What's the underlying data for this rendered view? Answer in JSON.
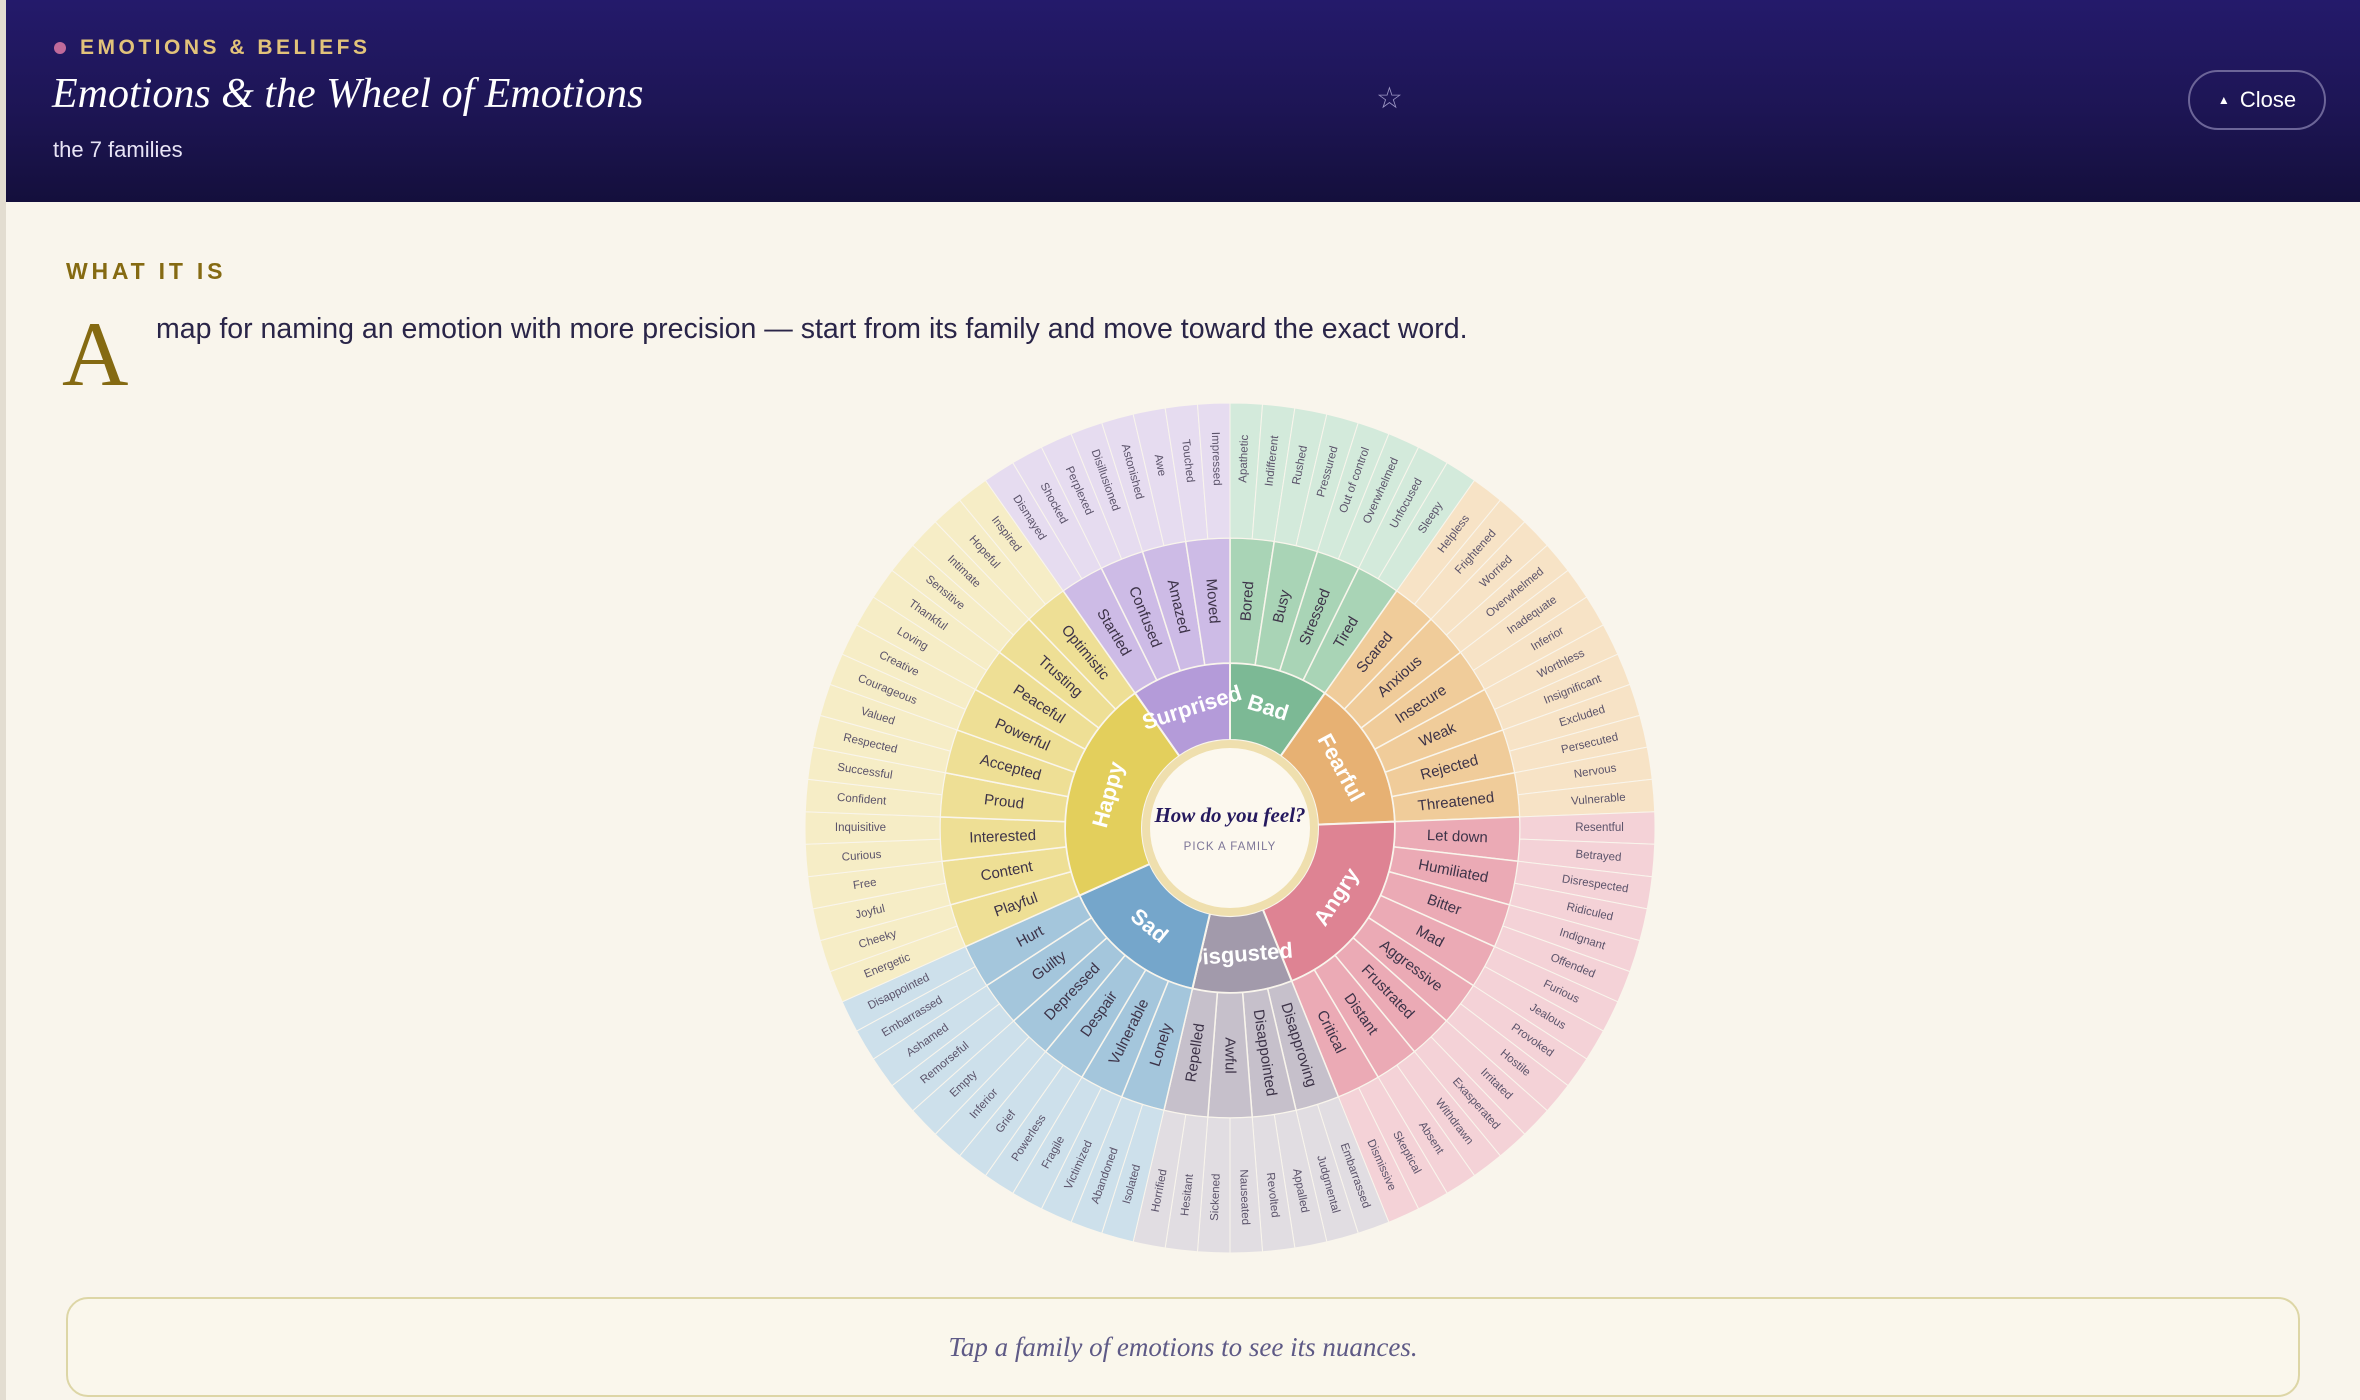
{
  "header": {
    "category": "EMOTIONS & BELIEFS",
    "title": "Emotions & the Wheel of Emotions",
    "subtitle": "the 7 families",
    "close_label": "Close",
    "favorite_icon": "star-outline-icon",
    "close_icon": "caret-up-icon"
  },
  "section": {
    "title": "WHAT IT IS",
    "dropcap": "A",
    "lead": "map for naming an emotion with more precision — start from its family and move toward the exact word."
  },
  "wheel": {
    "center_title": "How do you feel?",
    "center_sub": "PICK A FAMILY",
    "families": [
      {
        "name": "Bad",
        "color": "#7cb995",
        "mid": "#a9d4b6",
        "outer": "#d3eadb",
        "subs": [
          {
            "name": "Bored",
            "leaves": [
              "Apathetic",
              "Indifferent"
            ]
          },
          {
            "name": "Busy",
            "leaves": [
              "Rushed",
              "Pressured"
            ]
          },
          {
            "name": "Stressed",
            "leaves": [
              "Out of control",
              "Overwhelmed"
            ]
          },
          {
            "name": "Tired",
            "leaves": [
              "Unfocused",
              "Sleepy"
            ]
          }
        ]
      },
      {
        "name": "Fearful",
        "color": "#e7b173",
        "mid": "#f0cc9a",
        "outer": "#f7e3c6",
        "subs": [
          {
            "name": "Scared",
            "leaves": [
              "Helpless",
              "Frightened"
            ]
          },
          {
            "name": "Anxious",
            "leaves": [
              "Worried",
              "Overwhelmed"
            ]
          },
          {
            "name": "Insecure",
            "leaves": [
              "Inadequate",
              "Inferior"
            ]
          },
          {
            "name": "Weak",
            "leaves": [
              "Worthless",
              "Insignificant"
            ]
          },
          {
            "name": "Rejected",
            "leaves": [
              "Excluded",
              "Persecuted"
            ]
          },
          {
            "name": "Threatened",
            "leaves": [
              "Nervous",
              "Vulnerable"
            ]
          }
        ]
      },
      {
        "name": "Angry",
        "color": "#de8393",
        "mid": "#ebaab5",
        "outer": "#f4d2d7",
        "subs": [
          {
            "name": "Let down",
            "leaves": [
              "Resentful",
              "Betrayed"
            ]
          },
          {
            "name": "Humiliated",
            "leaves": [
              "Disrespected",
              "Ridiculed"
            ]
          },
          {
            "name": "Bitter",
            "leaves": [
              "Indignant",
              "Offended"
            ]
          },
          {
            "name": "Mad",
            "leaves": [
              "Furious",
              "Jealous"
            ]
          },
          {
            "name": "Aggressive",
            "leaves": [
              "Provoked",
              "Hostile"
            ]
          },
          {
            "name": "Frustrated",
            "leaves": [
              "Irritated",
              "Exasperated"
            ]
          },
          {
            "name": "Distant",
            "leaves": [
              "Withdrawn",
              "Absent"
            ]
          },
          {
            "name": "Critical",
            "leaves": [
              "Skeptical",
              "Dismissive"
            ]
          }
        ]
      },
      {
        "name": "Disgusted",
        "color": "#a29aab",
        "mid": "#c6c0cb",
        "outer": "#e1dde2",
        "subs": [
          {
            "name": "Disapproving",
            "leaves": [
              "Embarrassed",
              "Judgmental"
            ]
          },
          {
            "name": "Disappointed",
            "leaves": [
              "Appalled",
              "Revolted"
            ]
          },
          {
            "name": "Awful",
            "leaves": [
              "Nauseated",
              "Sickened"
            ]
          },
          {
            "name": "Repelled",
            "leaves": [
              "Hesitant",
              "Horrified"
            ]
          }
        ]
      },
      {
        "name": "Sad",
        "color": "#75a6cb",
        "mid": "#a4c6dc",
        "outer": "#cde0eb",
        "subs": [
          {
            "name": "Lonely",
            "leaves": [
              "Isolated",
              "Abandoned"
            ]
          },
          {
            "name": "Vulnerable",
            "leaves": [
              "Victimized",
              "Fragile"
            ]
          },
          {
            "name": "Despair",
            "leaves": [
              "Powerless",
              "Grief"
            ]
          },
          {
            "name": "Depressed",
            "leaves": [
              "Inferior",
              "Empty"
            ]
          },
          {
            "name": "Guilty",
            "leaves": [
              "Remorseful",
              "Ashamed"
            ]
          },
          {
            "name": "Hurt",
            "leaves": [
              "Embarrassed",
              "Disappointed"
            ]
          }
        ]
      },
      {
        "name": "Happy",
        "color": "#e3cf5c",
        "mid": "#eedf95",
        "outer": "#f6edc6",
        "subs": [
          {
            "name": "Playful",
            "leaves": [
              "Energetic",
              "Cheeky"
            ]
          },
          {
            "name": "Content",
            "leaves": [
              "Joyful",
              "Free"
            ]
          },
          {
            "name": "Interested",
            "leaves": [
              "Curious",
              "Inquisitive"
            ]
          },
          {
            "name": "Proud",
            "leaves": [
              "Confident",
              "Successful"
            ]
          },
          {
            "name": "Accepted",
            "leaves": [
              "Respected",
              "Valued"
            ]
          },
          {
            "name": "Powerful",
            "leaves": [
              "Courageous",
              "Creative"
            ]
          },
          {
            "name": "Peaceful",
            "leaves": [
              "Loving",
              "Thankful"
            ]
          },
          {
            "name": "Trusting",
            "leaves": [
              "Sensitive",
              "Intimate"
            ]
          },
          {
            "name": "Optimistic",
            "leaves": [
              "Hopeful",
              "Inspired"
            ]
          }
        ]
      },
      {
        "name": "Surprised",
        "color": "#b49bd9",
        "mid": "#cdbbe6",
        "outer": "#e6dcf0",
        "subs": [
          {
            "name": "Startled",
            "leaves": [
              "Dismayed",
              "Shocked"
            ]
          },
          {
            "name": "Confused",
            "leaves": [
              "Perplexed",
              "Disillusioned"
            ]
          },
          {
            "name": "Amazed",
            "leaves": [
              "Astonished",
              "Awe"
            ]
          },
          {
            "name": "Moved",
            "leaves": [
              "Touched",
              "Impressed"
            ]
          }
        ]
      }
    ]
  },
  "hint": "Tap a family of emotions to see its nuances."
}
